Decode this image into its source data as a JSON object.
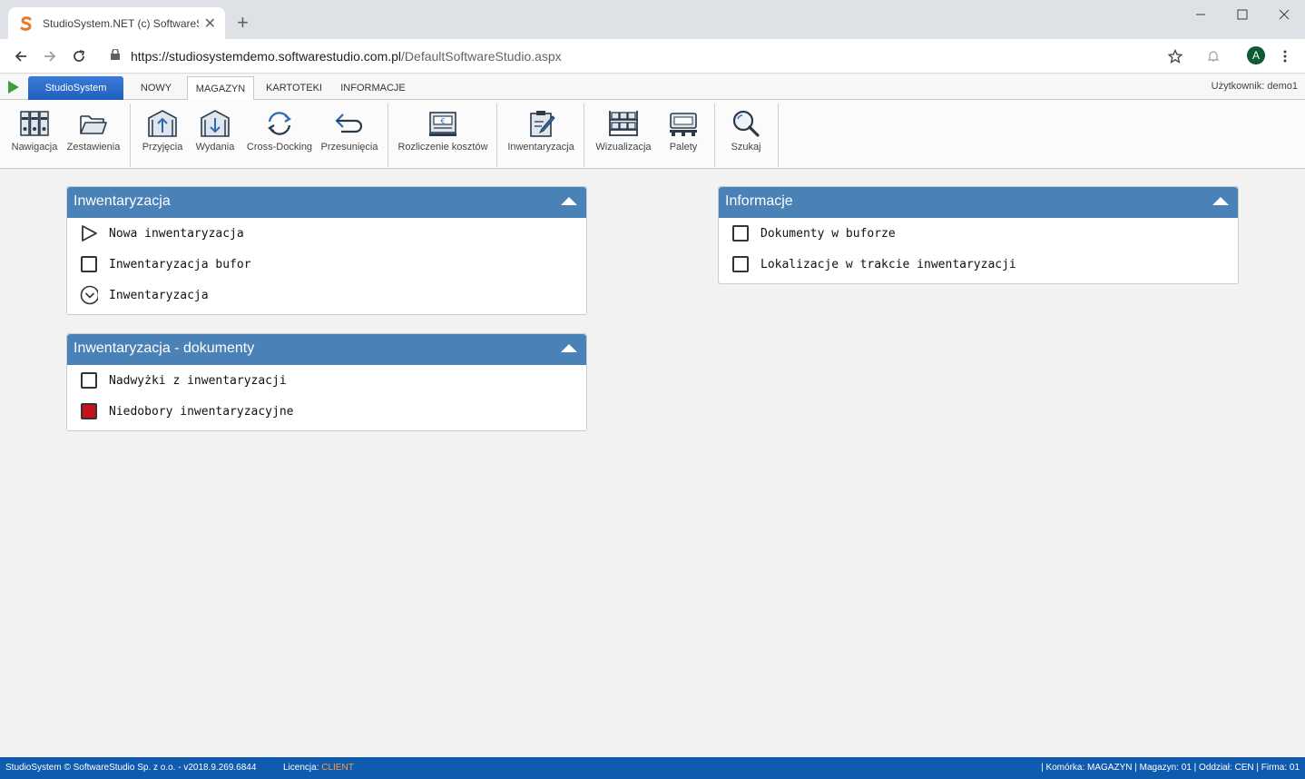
{
  "browser": {
    "tab_title": "StudioSystem.NET (c) SoftwareSt",
    "url_host": "https://studiosystemdemo.softwarestudio.com.pl",
    "url_path": "/DefaultSoftwareStudio.aspx",
    "avatar_letter": "A"
  },
  "app_tabs": {
    "brand": "StudioSystem",
    "items": [
      "NOWY",
      "MAGAZYN",
      "KARTOTEKI",
      "INFORMACJE"
    ],
    "active": "MAGAZYN",
    "user_label": "Użytkownik: demo1"
  },
  "ribbon": {
    "nawigacja": "Nawigacja",
    "zestawienia": "Zestawienia",
    "przyjecia": "Przyjęcia",
    "wydania": "Wydania",
    "crossdocking": "Cross-Docking",
    "przesuniecia": "Przesunięcia",
    "rozliczenie": "Rozliczenie kosztów",
    "inwentaryzacja": "Inwentaryzacja",
    "wizualizacja": "Wizualizacja",
    "palety": "Palety",
    "szukaj": "Szukaj"
  },
  "panel_inwent": {
    "title": "Inwentaryzacja",
    "items": [
      "Nowa inwentaryzacja",
      "Inwentaryzacja bufor",
      "Inwentaryzacja"
    ]
  },
  "panel_docs": {
    "title": "Inwentaryzacja - dokumenty",
    "items": [
      "Nadwyżki z inwentaryzacji",
      "Niedobory inwentaryzacyjne"
    ]
  },
  "panel_info": {
    "title": "Informacje",
    "items": [
      "Dokumenty w buforze",
      "Lokalizacje w trakcie inwentaryzacji"
    ]
  },
  "status": {
    "left": "StudioSystem © SoftwareStudio Sp. z o.o. - v2018.9.269.6844",
    "license_label": "Licencja:",
    "license_value": "CLIENT",
    "right": "| Komórka: MAGAZYN | Magazyn: 01 | Oddział: CEN | Firma: 01"
  },
  "colors": {
    "panel_header": "#4a82b8",
    "status_bar": "#0f5bb0",
    "brand_tab": "#1f5fbf",
    "danger_box": "#c8101a"
  }
}
